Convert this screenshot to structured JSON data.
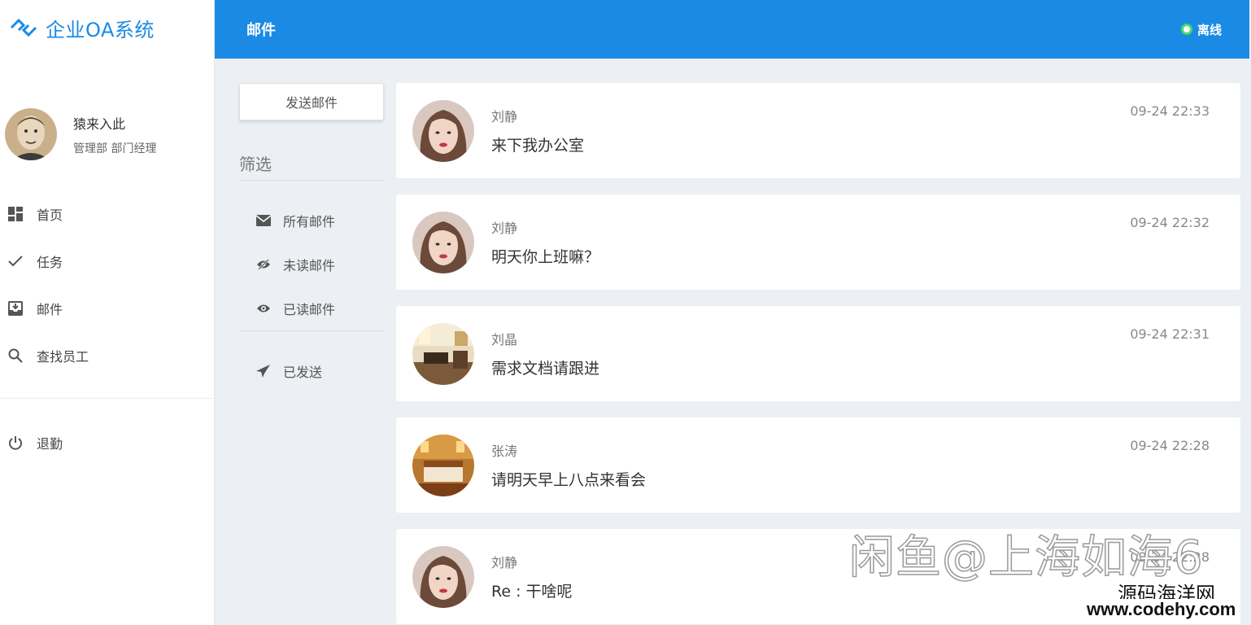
{
  "app": {
    "title": "企业OA系统",
    "brand_color": "#1a8ae5"
  },
  "user": {
    "name": "猿来入此",
    "department": "管理部 部门经理"
  },
  "sidebar": {
    "items": [
      {
        "label": "首页",
        "icon": "dashboard-icon"
      },
      {
        "label": "任务",
        "icon": "check-icon"
      },
      {
        "label": "邮件",
        "icon": "inbox-icon"
      },
      {
        "label": "查找员工",
        "icon": "search-icon"
      }
    ],
    "logout": {
      "label": "退勤",
      "icon": "power-icon"
    }
  },
  "header": {
    "title": "邮件",
    "status": "离线",
    "status_color": "#4cd964"
  },
  "filters": {
    "send_button": "发送邮件",
    "heading": "筛选",
    "items": [
      {
        "label": "所有邮件",
        "icon": "envelope-icon"
      },
      {
        "label": "未读邮件",
        "icon": "eye-slash-icon"
      },
      {
        "label": "已读邮件",
        "icon": "eye-icon"
      }
    ],
    "sent": {
      "label": "已发送",
      "icon": "paper-plane-icon"
    }
  },
  "mails": [
    {
      "sender": "刘静",
      "subject": "来下我办公室",
      "time": "09-24 22:33",
      "avatar": "woman-portrait"
    },
    {
      "sender": "刘静",
      "subject": "明天你上班嘛？",
      "time": "09-24 22:32",
      "avatar": "woman-portrait"
    },
    {
      "sender": "刘晶",
      "subject": "需求文档请跟进",
      "time": "09-24 22:31",
      "avatar": "room-photo"
    },
    {
      "sender": "张涛",
      "subject": "请明天早上八点来看会",
      "time": "09-24 22:28",
      "avatar": "hotel-room-photo"
    },
    {
      "sender": "刘静",
      "subject": "Re : 干啥呢",
      "time": "09-24 22:28",
      "avatar": "woman-portrait"
    }
  ],
  "watermark": {
    "main": "闲鱼@上海如海6",
    "site_name": "源码海洋网",
    "site_url": "www.codehy.com"
  }
}
